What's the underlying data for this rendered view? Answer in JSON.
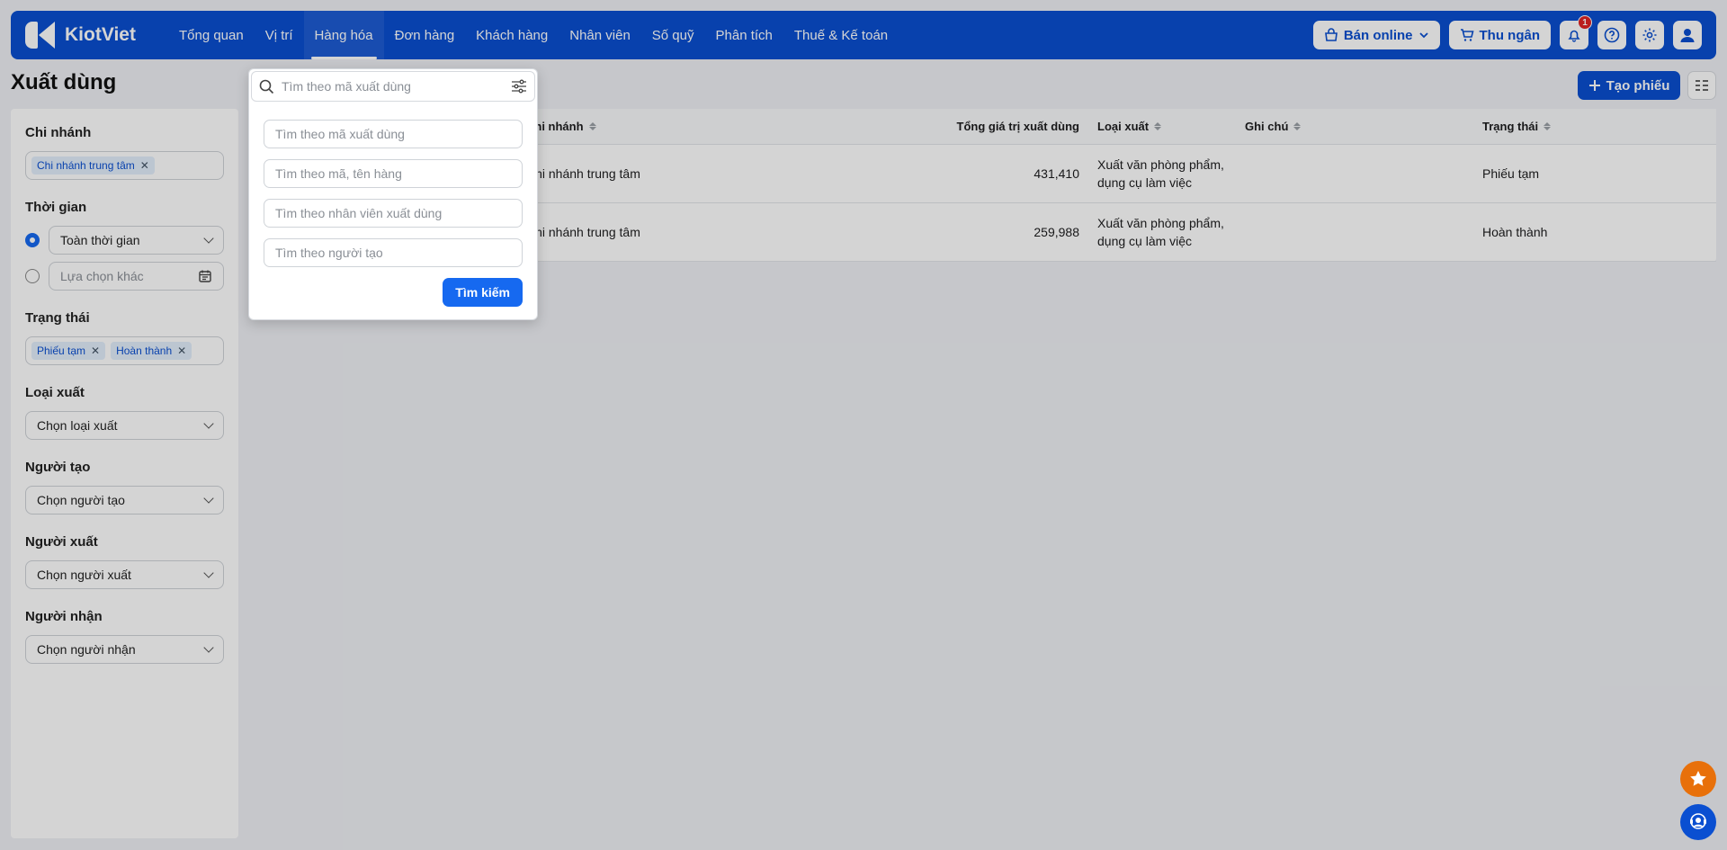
{
  "app": {
    "name": "KiotViet"
  },
  "nav": {
    "items": [
      {
        "label": "Tổng quan"
      },
      {
        "label": "Vị trí"
      },
      {
        "label": "Hàng hóa"
      },
      {
        "label": "Đơn hàng"
      },
      {
        "label": "Khách hàng"
      },
      {
        "label": "Nhân viên"
      },
      {
        "label": "Số quỹ"
      },
      {
        "label": "Phân tích"
      },
      {
        "label": "Thuế & Kế toán"
      }
    ],
    "active_index": 2,
    "online_label": "Bán online",
    "cashier_label": "Thu ngân",
    "notification_count": "1"
  },
  "page": {
    "title": "Xuất dùng",
    "create_label": "Tạo phiếu"
  },
  "filters": {
    "branch": {
      "label": "Chi nhánh",
      "tags": [
        "Chi nhánh trung tâm"
      ]
    },
    "time": {
      "label": "Thời gian",
      "option_all": "Toàn thời gian",
      "option_custom": "Lựa chọn khác"
    },
    "status": {
      "label": "Trạng thái",
      "tags": [
        "Phiếu tạm",
        "Hoàn thành"
      ]
    },
    "export_type": {
      "label": "Loại xuất",
      "placeholder": "Chọn loại xuất"
    },
    "creator": {
      "label": "Người tạo",
      "placeholder": "Chọn người tạo"
    },
    "exporter": {
      "label": "Người xuất",
      "placeholder": "Chọn người xuất"
    },
    "receiver": {
      "label": "Người nhận",
      "placeholder": "Chọn người nhận"
    }
  },
  "search": {
    "placeholder": "Tìm theo mã xuất dùng",
    "fields": [
      "Tìm theo mã xuất dùng",
      "Tìm theo mã, tên hàng",
      "Tìm theo nhân viên xuất dùng",
      "Tìm theo người tạo"
    ],
    "button_label": "Tìm kiếm"
  },
  "table": {
    "headers": {
      "branch": "Chi nhánh",
      "total": "Tổng giá trị xuất dùng",
      "type": "Loại xuất",
      "note": "Ghi chú",
      "status": "Trạng thái"
    },
    "rows": [
      {
        "branch": "Chi nhánh trung tâm",
        "total": "431,410",
        "type_line1": "Xuất văn phòng phẩm,",
        "type_line2": "dụng cụ làm việc",
        "note": "",
        "status": "Phiếu tạm"
      },
      {
        "branch": "Chi nhánh trung tâm",
        "total": "259,988",
        "type_line1": "Xuất văn phòng phẩm,",
        "type_line2": "dụng cụ làm việc",
        "note": "",
        "status": "Hoàn thành"
      }
    ]
  },
  "colors": {
    "primary": "#0a4fd1",
    "accent": "#1669f0",
    "star": "#e8700a",
    "badge": "#e02424"
  }
}
